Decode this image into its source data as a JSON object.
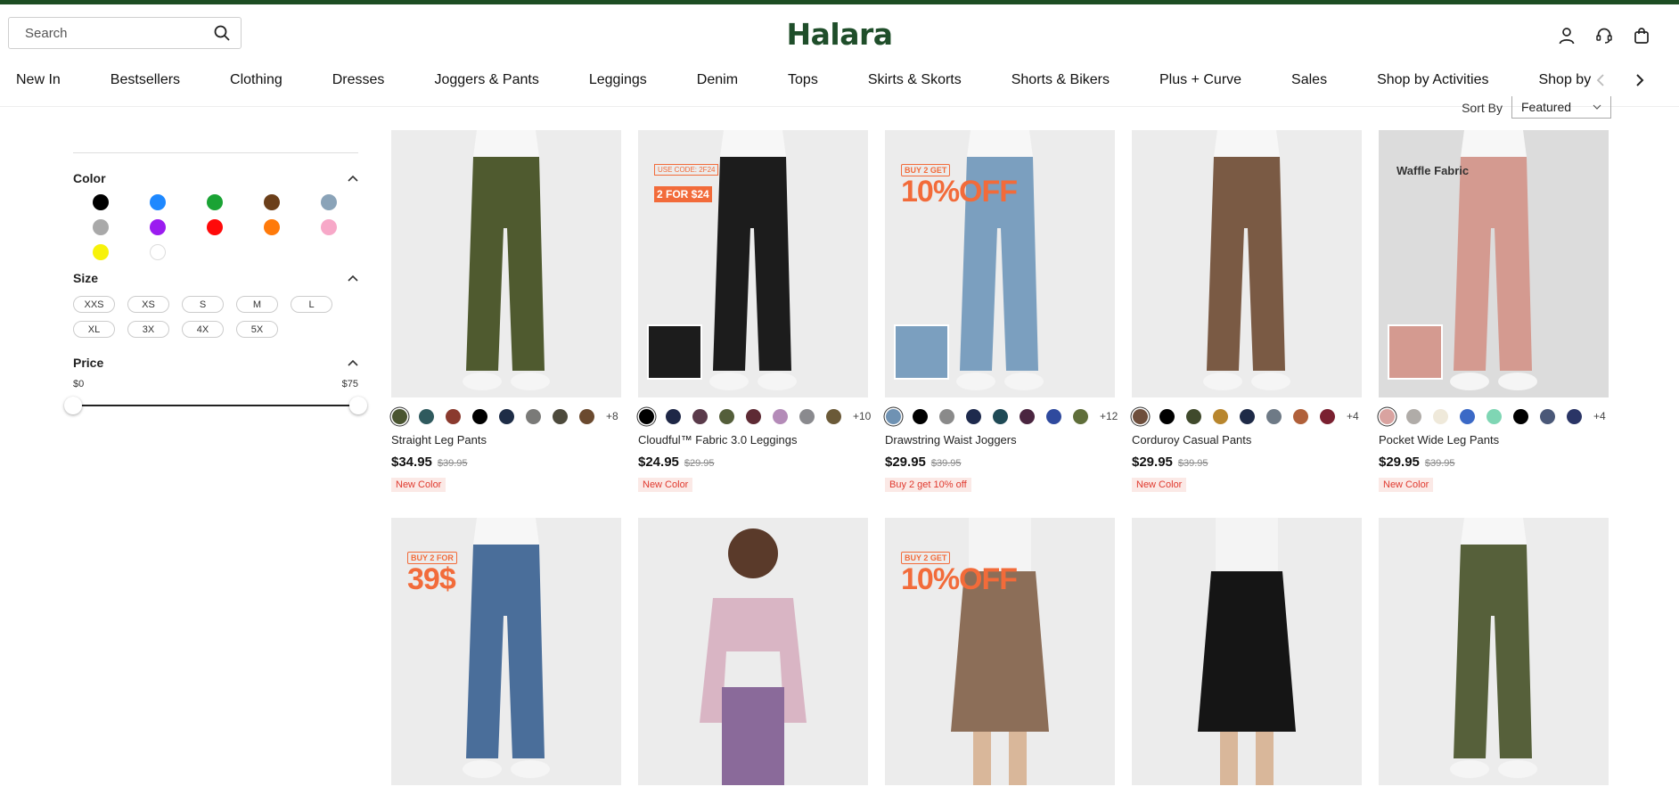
{
  "header": {
    "search_placeholder": "Search",
    "logo": "Halara"
  },
  "nav": {
    "items": [
      "New In",
      "Bestsellers",
      "Clothing",
      "Dresses",
      "Joggers & Pants",
      "Leggings",
      "Denim",
      "Tops",
      "Skirts & Skorts",
      "Shorts & Bikers",
      "Plus + Curve",
      "Sales",
      "Shop by Activities",
      "Shop by St"
    ]
  },
  "sort": {
    "label": "Sort By",
    "value": "Featured"
  },
  "filters": {
    "color": {
      "title": "Color",
      "swatches": [
        "#000000",
        "#1e88ff",
        "#1aa334",
        "#6b3f1a",
        "#8aa3b8",
        "#a9a9a9",
        "#9b1cf0",
        "#ff0a0a",
        "#ff7a0a",
        "#f7a8c8",
        "#f7f20a",
        "#ffffff"
      ]
    },
    "size": {
      "title": "Size",
      "options": [
        "XXS",
        "XS",
        "S",
        "M",
        "L",
        "XL",
        "3X",
        "4X",
        "5X"
      ]
    },
    "price": {
      "title": "Price",
      "min": "$0",
      "max": "$75"
    }
  },
  "products": [
    {
      "name": "Straight Leg Pants",
      "price": "$34.95",
      "original": "$39.95",
      "badge": "New Color",
      "bg": "#ececec",
      "garment": "#4f5a2f",
      "swatches": [
        "#4a5531",
        "#2f5a5e",
        "#8a3a2e",
        "#000000",
        "#1e2d47",
        "#7a7a78",
        "#4d4a3c",
        "#6b4a2f"
      ],
      "more": "+8"
    },
    {
      "name": "Cloudful™ Fabric 3.0 Leggings",
      "price": "$24.95",
      "original": "$29.95",
      "badge": "New Color",
      "bg": "#ececec",
      "garment": "#1c1c1c",
      "promo_code": "USE CODE: 2F24",
      "promo_deal": "2 FOR $24",
      "swatches": [
        "#000000",
        "#1e2746",
        "#5a3a4a",
        "#545e3a",
        "#5e2a34",
        "#b48bb8",
        "#8a8a8e",
        "#6b5a38"
      ],
      "more": "+10"
    },
    {
      "name": "Drawstring Waist Joggers",
      "price": "$29.95",
      "original": "$39.95",
      "badge": "Buy 2 get 10% off",
      "bg": "#ececec",
      "garment": "#7b9fbf",
      "promo_small": "BUY 2 GET",
      "promo_big": "10%OFF",
      "swatches": [
        "#6f92b3",
        "#000000",
        "#8a8a8a",
        "#1e2a4d",
        "#1f4a56",
        "#4a2540",
        "#2f4a9e",
        "#5f6e3a"
      ],
      "more": "+12"
    },
    {
      "name": "Corduroy Casual Pants",
      "price": "$29.95",
      "original": "$39.95",
      "badge": "New Color",
      "bg": "#ececec",
      "garment": "#7a5a44",
      "swatches": [
        "#6e4e3c",
        "#000000",
        "#404a2c",
        "#b8862e",
        "#1e2a47",
        "#6e7a86",
        "#b0603a",
        "#7a2030"
      ],
      "more": "+4"
    },
    {
      "name": "Pocket Wide Leg Pants",
      "price": "$29.95",
      "original": "$39.95",
      "badge": "New Color",
      "bg": "#dcdcdc",
      "garment": "#d49a90",
      "overlay": "Waffle Fabric",
      "swatches": [
        "#d9a3a0",
        "#b0aca8",
        "#efe9da",
        "#3b69c6",
        "#7fd6b4",
        "#000000",
        "#4a5878",
        "#2a3566"
      ],
      "more": "+4"
    },
    {
      "bg": "#ececec",
      "garment": "#4a6e9a",
      "promo_small": "BUY 2 FOR",
      "promo_big": "39$"
    },
    {
      "bg": "#ececec",
      "garment": "#d9b5c4"
    },
    {
      "bg": "#ececec",
      "garment": "#8c6e58",
      "promo_small": "BUY 2 GET",
      "promo_big": "10%OFF"
    },
    {
      "bg": "#ececec",
      "garment": "#151515"
    },
    {
      "bg": "#ececec",
      "garment": "#56603a"
    }
  ]
}
